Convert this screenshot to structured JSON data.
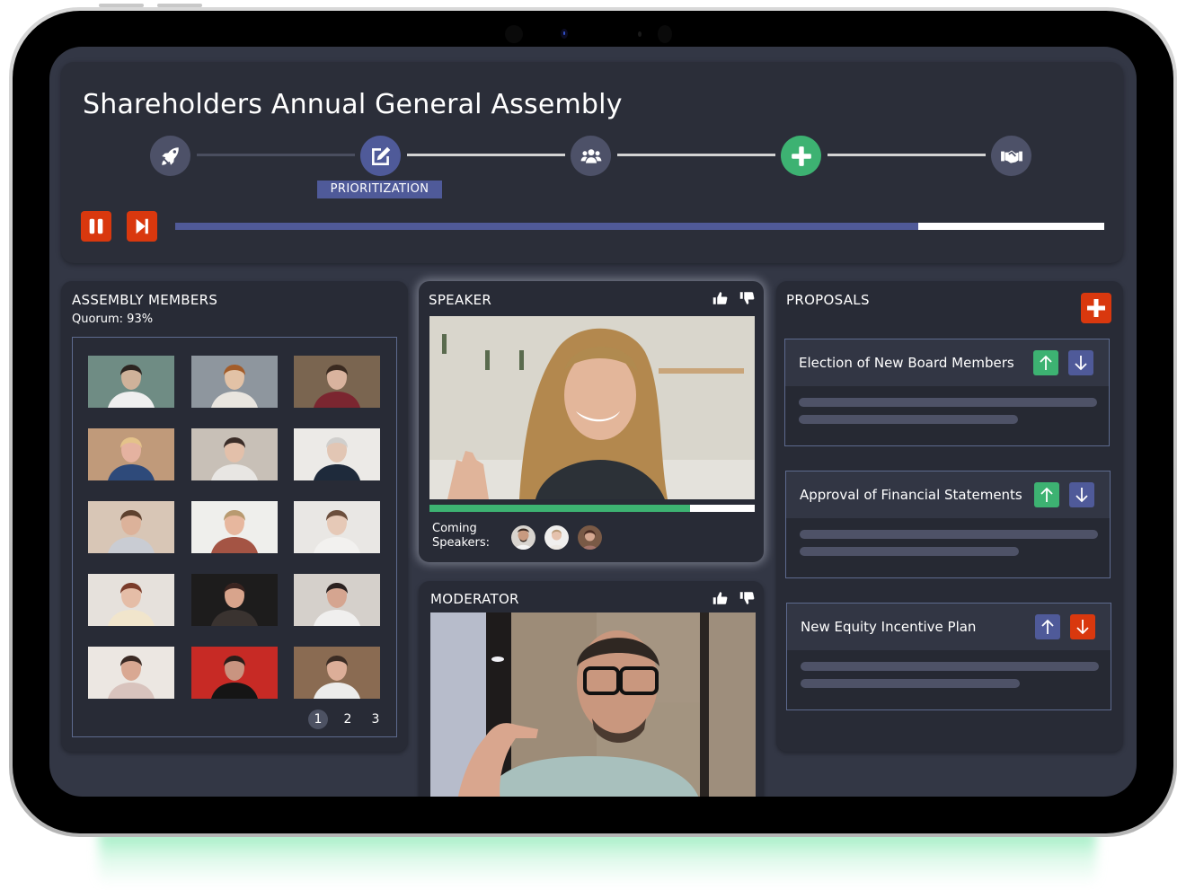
{
  "app": {
    "title": "Shareholders Annual General Assembly"
  },
  "stages": {
    "items": [
      {
        "icon": "rocket-icon",
        "state": "done"
      },
      {
        "icon": "edit-icon",
        "state": "active",
        "label": "PRIORITIZATION"
      },
      {
        "icon": "users-icon",
        "state": "upcoming"
      },
      {
        "icon": "plus-icon",
        "state": "highlight"
      },
      {
        "icon": "handshake-icon",
        "state": "upcoming"
      }
    ],
    "active_label": "PRIORITIZATION"
  },
  "controls": {
    "pause_icon": "pause-icon",
    "skip_icon": "skip-forward-icon",
    "progress_fraction": 0.8
  },
  "members": {
    "title": "ASSEMBLY MEMBERS",
    "quorum": "Quorum: 93%",
    "tiles": [
      {
        "name": "Man with headphones"
      },
      {
        "name": "Woman on sofa"
      },
      {
        "name": "Woman in kitchen"
      },
      {
        "name": "Blonde woman"
      },
      {
        "name": "Smiling woman"
      },
      {
        "name": "Woman with glasses"
      },
      {
        "name": "Woman drinking"
      },
      {
        "name": "Man with glasses"
      },
      {
        "name": "Woman in white"
      },
      {
        "name": "Woman with headphones"
      },
      {
        "name": "Smiling woman dark hair"
      },
      {
        "name": "Bearded man"
      },
      {
        "name": "Woman hand on chin"
      },
      {
        "name": "Woman red wall"
      },
      {
        "name": "Smiling man"
      }
    ],
    "pages": [
      "1",
      "2",
      "3"
    ],
    "current_page": "1"
  },
  "speaker": {
    "title": "SPEAKER",
    "like_icon": "thumbs-up-icon",
    "dislike_icon": "thumbs-down-icon",
    "talk_time_fraction": 0.8,
    "coming_label_1": "Coming",
    "coming_label_2": "Speakers:",
    "coming_speakers": [
      "Man with beard",
      "Woman blonde",
      "Woman dark hair"
    ]
  },
  "moderator": {
    "title": "MODERATOR",
    "like_icon": "thumbs-up-icon",
    "dislike_icon": "thumbs-down-icon"
  },
  "proposals": {
    "title": "PROPOSALS",
    "add_icon": "plus-icon",
    "items": [
      {
        "title": "Election of New Board Members",
        "up_color": "#3db272",
        "down_color": "#4f5a99"
      },
      {
        "title": "Approval of Financial Statements",
        "up_color": "#3db272",
        "down_color": "#4f5a99"
      },
      {
        "title": "New Equity Incentive Plan",
        "up_color": "#4f5a99",
        "down_color": "#d9380e"
      }
    ]
  },
  "colors": {
    "accent": "#4f5a99",
    "success": "#3db272",
    "danger": "#d9380e",
    "background": "#333745",
    "panel": "#282b36"
  }
}
